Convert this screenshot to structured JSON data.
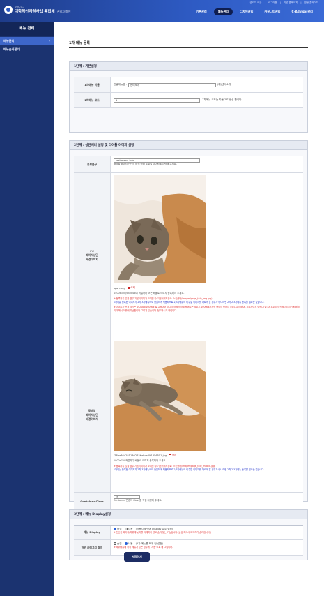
{
  "header": {
    "logo_sub": "국립대학교",
    "logo_main": "대학역신지원사업 통합체",
    "logo_admin": "관리자 화면",
    "top_links": [
      "관리자 메뉴",
      "로그아웃",
      "기본 홈페이지",
      "영문 홈페이지"
    ],
    "gnb": [
      "기본관리",
      "메뉴관리",
      "디자인관리",
      "커뮤니티관리",
      "C-Advisor관리"
    ],
    "active_gnb": "메뉴관리"
  },
  "sidebar": {
    "title": "메뉴 관리",
    "items": [
      {
        "label": "메뉴관리",
        "mark": "–",
        "active": true
      },
      {
        "label": "메뉴순서관리",
        "mark": "",
        "active": false
      }
    ]
  },
  "page": {
    "title": "1차 메뉴 등록"
  },
  "section1": {
    "title": "1단계 : 기본설정",
    "name_label": "1차메뉴 이름",
    "name_prefix": "한글메뉴명 :",
    "name_value": "센터소개",
    "name_hint": "(예)센터소개",
    "code_label": "1차메뉴 코드",
    "code_value": "1",
    "code_hint": "1차메뉴 코드는 자동으로 생성 합니다."
  },
  "section2": {
    "title": "2단계 : 상단배너 설정 및 타이틀 이미지 설정",
    "slogan_label": "홍보문구",
    "slogan_value": "test menu info",
    "slogan_note": "배경을 위에서 선단의 배색 아래 노출될 마이팀을 입력해 주세요.",
    "pc_label": "PC\n페이지상단\n배경이미지",
    "pc_filename": "span.png",
    "pc_delete": "삭제",
    "pc_size_note": "1500x300(640x480) 적절하다 또는 배율로 이미지 등록해야 주세요.",
    "pc_red1": "※ 등록하지 않을 경우 기본이미지가 보여진 다(기본이미지경로: 스킨폴더/images/page_title_img.jpg)",
    "pc_blue1": "1차메뉴 등록한 이미지가 2차 3차메뉴에도 동일하게 적용되므로 2,3차메뉴에 비주얼 이미지를 다르게 할 경우가 아니라면 2차 2,3차메뉴 등록할 필요는 없습니다.",
    "pc_red2": "※ 이미지가 변경 크기는 1920px(1600px)로 고정이며 아니 해상에서 상세 중에도는 부분은 1000px까지를 중심이 편하지 않습니다(처해야, 최소사이즈 랄한다(실) 이 부분은 이전에 사라지기에 해내기 위해서 이를에 무난합니다 그렇게 있습니다. 정교하시기 바랍니다.",
    "mobile_label": "모바일\n페이지상단\n배경이미지",
    "mobile_filename": "f78ea3642811302636abcef0f1356551.jpg",
    "mobile_delete": "삭제",
    "mobile_size_note": "1000x700적절하다 배율로 이미지 등록해야 주세요.",
    "mobile_red1": "※ 등록하지 않을 경우 기본이미지가 보여진 다(기본이미지경로: 스킨폴더/images/page_title_mobile.jpg)",
    "mobile_blue1": "1차메뉴 등록한 이미지가 2차 3차메뉴에도 동일하게 적용되므로 2,3차메뉴에 비주얼 이미지를 다르게 할 경우가 아니라면 2차 2,3차메뉴 등록할 필요는 없습니다.",
    "container_label": "Container Class",
    "container_value": "cs",
    "container_note": "Container 변경이 Class를 직접 지정해 주세요."
  },
  "section3": {
    "title": "3단계 : 메뉴 Display설정",
    "display_label": "메뉴 Display",
    "display_opt1": "숨김",
    "display_opt2": "사용",
    "display_text": "(사용시 화면에 Display 유무 설정)",
    "display_red": "※ 전산된 페이지(하위메뉴)이를 삭제하지 않고 숨겨 놓는 기능입니다.(숨김 해그서 페이지가 숨겨집니다.)",
    "sub_label": "하위 카테고리 설정",
    "sub_opt1": "숨김",
    "sub_opt2": "사용",
    "sub_text": "(2차 메뉴를 화위 탐 설정)",
    "sub_red": "※ 하위메뉴에 하위 메뉴가 있는 경우에 \"사용\"으로 해 그립니다."
  },
  "save_label": "저장하기",
  "colors": {
    "header": "#2e5bc4",
    "sidebar": "#1b3370",
    "sidebar_active": "#3d66c9",
    "save_button": "#1c2c63"
  }
}
